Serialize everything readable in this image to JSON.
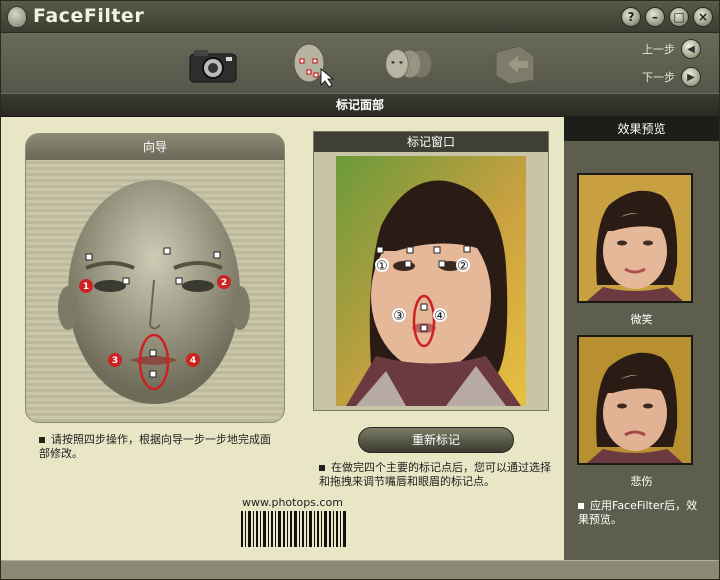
{
  "app": {
    "title_part1": "Face",
    "title_part2": "Filter"
  },
  "window_buttons": [
    "?",
    "–",
    "□",
    "×"
  ],
  "toolbar": {
    "prev_label": "上一步",
    "next_label": "下一步"
  },
  "section_title": "标记面部",
  "guide": {
    "title": "向导",
    "markers": [
      "1",
      "2",
      "3",
      "4"
    ],
    "note": "请按照四步操作，根据向导一步一步地完成面部修改。"
  },
  "mark_window": {
    "title": "标记窗口",
    "markers": [
      "①",
      "②",
      "③",
      "④"
    ]
  },
  "redo_button": "重新标记",
  "mark_note": "在做完四个主要的标记点后，您可以通过选择和拖拽来调节嘴唇和眼眉的标记点。",
  "website": "www.photops.com",
  "preview": {
    "title": "效果预览",
    "items": [
      {
        "label": "微笑"
      },
      {
        "label": "悲伤"
      }
    ],
    "note": "应用FaceFilter后，效果预览。"
  },
  "colors": {
    "accent_red": "#cc2222",
    "panel_bg": "#e9e6c6"
  }
}
